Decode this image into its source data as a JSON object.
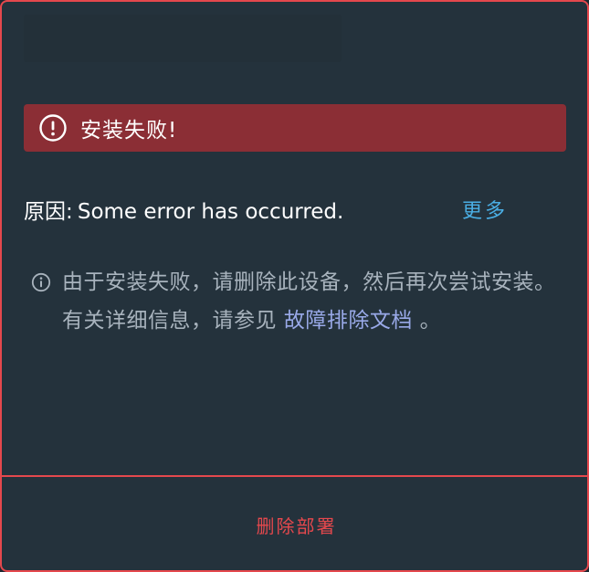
{
  "banner": {
    "title": "安装失败!",
    "icon": "alert-circle-icon"
  },
  "reason": {
    "label": "原因:",
    "value": "Some error has occurred.",
    "more_label": "更多"
  },
  "info": {
    "icon": "info-circle-icon",
    "text_before_link": "由于安装失败，请删除此设备，然后再次尝试安装。 有关详细信息，请参见",
    "link_label": "故障排除文档",
    "text_after_link": "。"
  },
  "footer": {
    "delete_label": "删除部署"
  },
  "colors": {
    "card_bg": "#24323c",
    "accent_danger": "#e5484d",
    "banner_bg": "#8b2e35",
    "link_blue": "#4aaee4",
    "doc_link": "#99a9e8",
    "muted_text": "#a8b3bd"
  }
}
